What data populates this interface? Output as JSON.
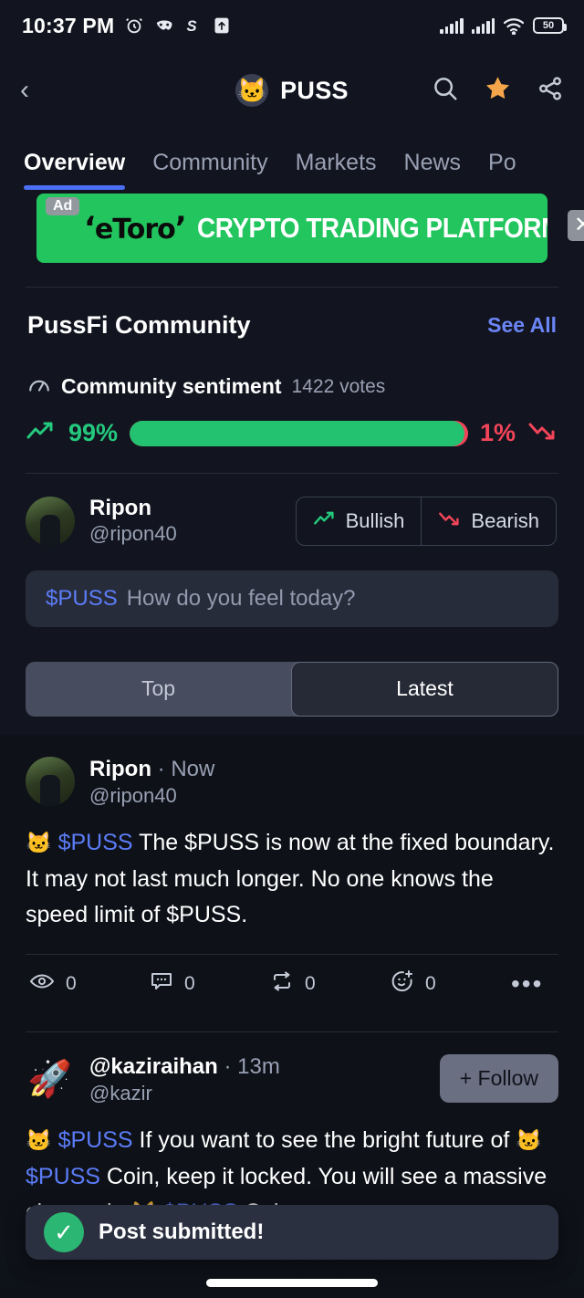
{
  "status_bar": {
    "time": "10:37 PM",
    "left_icons": [
      "alarm-icon",
      "mask-app-icon",
      "s-app-icon",
      "upload-icon"
    ],
    "battery_level": "50",
    "right_icons": [
      "signal-bars-1",
      "signal-bars-2",
      "wifi-icon",
      "battery-icon"
    ]
  },
  "header": {
    "back_icon": "chevron-left-icon",
    "coin_emoji": "🐱",
    "title": "PUSS",
    "actions": [
      "search-icon",
      "star-icon",
      "share-icon"
    ],
    "star_color": "#f5a64a"
  },
  "tabs": [
    {
      "label": "Overview",
      "active": true
    },
    {
      "label": "Community",
      "active": false
    },
    {
      "label": "Markets",
      "active": false
    },
    {
      "label": "News",
      "active": false
    },
    {
      "label": "Po",
      "active": false
    }
  ],
  "ad": {
    "badge": "Ad",
    "brand": "eToro",
    "headline": "CRYPTO TRADING PLATFORM",
    "close_label": "✕",
    "background": "#22c55e"
  },
  "community": {
    "title": "PussFi Community",
    "see_all": "See All",
    "sentiment": {
      "label": "Community sentiment",
      "votes": "1422 votes",
      "bullish_pct": "99%",
      "bearish_pct": "1%",
      "bullish_value": 99,
      "bearish_value": 1,
      "bullish_color": "#22c270",
      "bearish_color": "#f4445a"
    },
    "me": {
      "name": "Ripon",
      "handle": "@ripon40",
      "bullish_label": "Bullish",
      "bearish_label": "Bearish"
    },
    "composer": {
      "cashtag": "$PUSS",
      "placeholder": "How do you feel today?"
    },
    "sort": [
      {
        "label": "Top",
        "active": false
      },
      {
        "label": "Latest",
        "active": true
      }
    ]
  },
  "posts": [
    {
      "name": "Ripon",
      "time": "Now",
      "handle": "@ripon40",
      "avatar": "photo",
      "follow": null,
      "cashtag": "$PUSS",
      "body_prefix": "",
      "body": " The $PUSS is now at the fixed boundary.  It may not last much longer. No one knows the speed limit of $PUSS.",
      "actions": [
        {
          "icon": "eye-icon",
          "count": "0"
        },
        {
          "icon": "comment-icon",
          "count": "0"
        },
        {
          "icon": "repost-icon",
          "count": "0"
        },
        {
          "icon": "reaction-icon",
          "count": "0"
        }
      ],
      "more": "•••"
    },
    {
      "name": "@kaziraihan",
      "time": "13m",
      "handle": "@kazir",
      "avatar": "🚀",
      "follow": "+ Follow",
      "cashtag": "$PUSS",
      "body_line1": " If you want to see the bright future of",
      "body_line2": " Coin, keep it locked. You will see a",
      "body_line3": " Coin very soon.",
      "body_line3_prefix": "massive change in "
    }
  ],
  "toast": {
    "icon": "check-icon",
    "message": "Post submitted!",
    "icon_color": "#2bb673"
  }
}
